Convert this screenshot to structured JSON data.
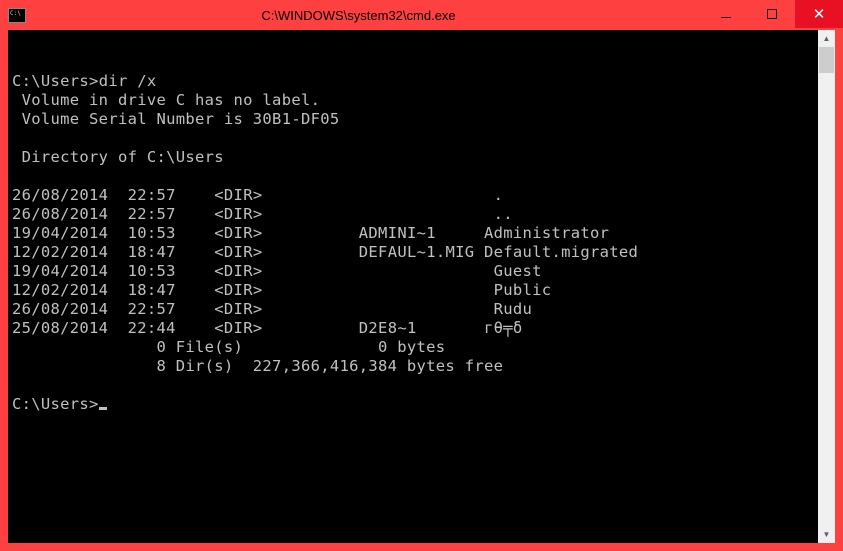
{
  "window": {
    "title": "C:\\WINDOWS\\system32\\cmd.exe"
  },
  "prompt1": {
    "path": "C:\\Users>",
    "command": "dir /x"
  },
  "volume": {
    "line1": " Volume in drive C has no label.",
    "line2": " Volume Serial Number is 30B1-DF05"
  },
  "directory_header": " Directory of C:\\Users",
  "entries": [
    {
      "date": "26/08/2014",
      "time": "22:57",
      "type": "<DIR>",
      "shortname": "",
      "name": "."
    },
    {
      "date": "26/08/2014",
      "time": "22:57",
      "type": "<DIR>",
      "shortname": "",
      "name": ".."
    },
    {
      "date": "19/04/2014",
      "time": "10:53",
      "type": "<DIR>",
      "shortname": "ADMINI~1",
      "name": "Administrator"
    },
    {
      "date": "12/02/2014",
      "time": "18:47",
      "type": "<DIR>",
      "shortname": "DEFAUL~1.MIG",
      "name": "Default.migrated"
    },
    {
      "date": "19/04/2014",
      "time": "10:53",
      "type": "<DIR>",
      "shortname": "",
      "name": "Guest"
    },
    {
      "date": "12/02/2014",
      "time": "18:47",
      "type": "<DIR>",
      "shortname": "",
      "name": "Public"
    },
    {
      "date": "26/08/2014",
      "time": "22:57",
      "type": "<DIR>",
      "shortname": "",
      "name": "Rudu"
    },
    {
      "date": "25/08/2014",
      "time": "22:44",
      "type": "<DIR>",
      "shortname": "D2E8~1",
      "name": "гθ╤δ"
    }
  ],
  "summary": {
    "files_line": "               0 File(s)              0 bytes",
    "dirs_line": "               8 Dir(s)  227,366,416,384 bytes free"
  },
  "prompt2": {
    "path": "C:\\Users>"
  }
}
